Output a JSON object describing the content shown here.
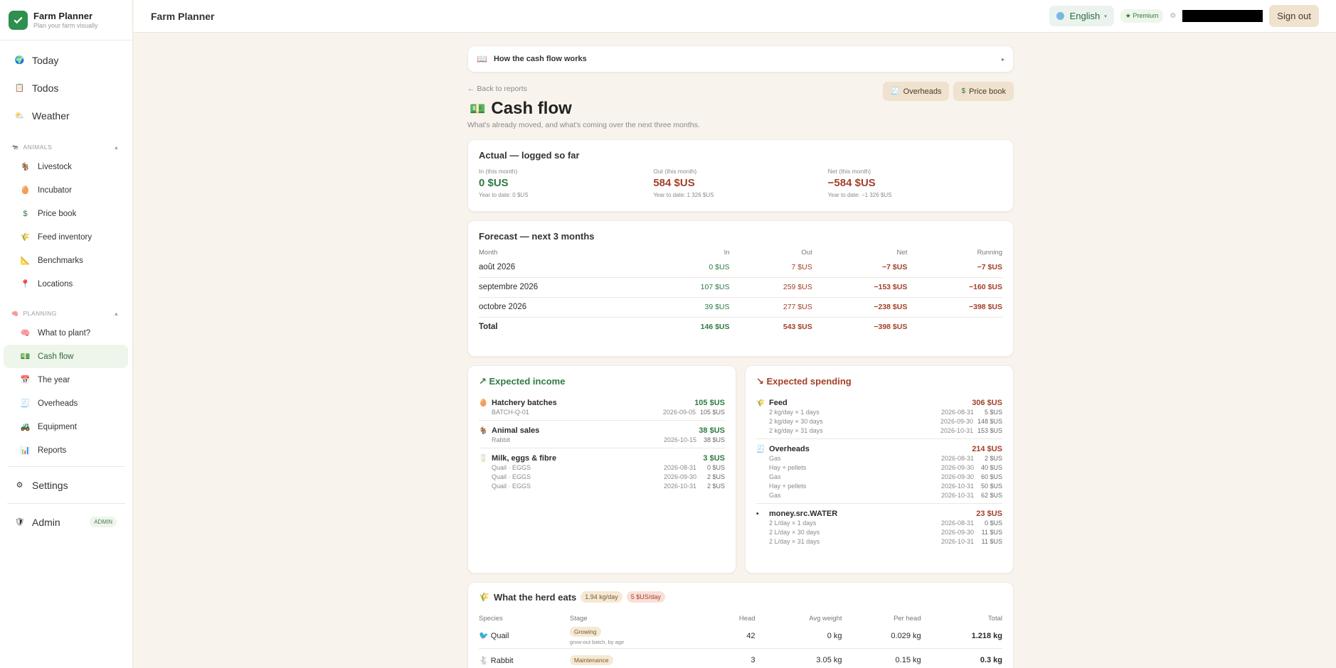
{
  "brand": {
    "title": "Farm Planner",
    "subtitle": "Plan your farm visually"
  },
  "topbar": {
    "title": "Farm Planner",
    "language": "English",
    "premium": "★ Premium",
    "sign_out": "Sign out"
  },
  "nav": {
    "today": "Today",
    "todos": "Todos",
    "weather": "Weather",
    "animals_section": "ANIMALS",
    "animals": [
      "Livestock",
      "Incubator",
      "Price book",
      "Feed inventory",
      "Benchmarks",
      "Locations"
    ],
    "planning_section": "PLANNING",
    "planning": [
      "What to plant?",
      "Cash flow",
      "The year",
      "Overheads",
      "Equipment",
      "Reports"
    ],
    "settings": "Settings",
    "admin": "Admin",
    "admin_badge": "ADMIN"
  },
  "howto": {
    "label": "How the cash flow works",
    "arrow": "▸"
  },
  "header": {
    "back": "← Back to reports",
    "overheads_btn": "Overheads",
    "pricebook_btn": "Price book",
    "title": "Cash flow",
    "subtitle": "What's already moved, and what's coming over the next three months."
  },
  "actual": {
    "title": "Actual — logged so far",
    "metrics": [
      {
        "label": "In (this month)",
        "value": "0 $US",
        "ytd": "Year to date: 0 $US"
      },
      {
        "label": "Out (this month)",
        "value": "584 $US",
        "ytd": "Year to date: 1 326 $US"
      },
      {
        "label": "Net (this month)",
        "value": "−584 $US",
        "ytd": "Year to date: −1 326 $US"
      }
    ]
  },
  "forecast": {
    "title": "Forecast — next 3 months",
    "columns": [
      "Month",
      "In",
      "Out",
      "Net",
      "Running"
    ],
    "rows": [
      [
        "août 2026",
        "0 $US",
        "7 $US",
        "−7 $US",
        "−7 $US"
      ],
      [
        "septembre 2026",
        "107 $US",
        "259 $US",
        "−153 $US",
        "−160 $US"
      ],
      [
        "octobre 2026",
        "39 $US",
        "277 $US",
        "−238 $US",
        "−398 $US"
      ]
    ],
    "total": [
      "Total",
      "146 $US",
      "543 $US",
      "−398 $US",
      ""
    ]
  },
  "income": {
    "title": "↗ Expected income",
    "groups": [
      {
        "name": "Hatchery batches",
        "total": "105 $US",
        "lines": [
          [
            "BATCH-Q-01",
            "2026-09-05",
            "105 $US"
          ]
        ]
      },
      {
        "name": "Animal sales",
        "total": "38 $US",
        "lines": [
          [
            "Rabbit",
            "2026-10-15",
            "38 $US"
          ]
        ]
      },
      {
        "name": "Milk, eggs & fibre",
        "total": "3 $US",
        "lines": [
          [
            "Quail · EGGS",
            "2026-08-31",
            "0 $US"
          ],
          [
            "Quail · EGGS",
            "2026-09-30",
            "2 $US"
          ],
          [
            "Quail · EGGS",
            "2026-10-31",
            "2 $US"
          ]
        ]
      }
    ]
  },
  "spending": {
    "title": "↘ Expected spending",
    "groups": [
      {
        "name": "Feed",
        "total": "306 $US",
        "lines": [
          [
            "2 kg/day × 1 days",
            "2026-08-31",
            "5 $US"
          ],
          [
            "2 kg/day × 30 days",
            "2026-09-30",
            "148 $US"
          ],
          [
            "2 kg/day × 31 days",
            "2026-10-31",
            "153 $US"
          ]
        ]
      },
      {
        "name": "Overheads",
        "total": "214 $US",
        "lines": [
          [
            "Gas",
            "2026-08-31",
            "2 $US"
          ],
          [
            "Hay + pellets",
            "2026-09-30",
            "40 $US"
          ],
          [
            "Gas",
            "2026-09-30",
            "60 $US"
          ],
          [
            "Hay + pellets",
            "2026-10-31",
            "50 $US"
          ],
          [
            "Gas",
            "2026-10-31",
            "62 $US"
          ]
        ]
      },
      {
        "name": "money.src.WATER",
        "total": "23 $US",
        "lines": [
          [
            "2 L/day × 1 days",
            "2026-08-31",
            "0 $US"
          ],
          [
            "2 L/day × 30 days",
            "2026-09-30",
            "11 $US"
          ],
          [
            "2 L/day × 31 days",
            "2026-10-31",
            "11 $US"
          ]
        ]
      }
    ]
  },
  "herd": {
    "title": "What the herd eats",
    "chip1": "1.94 kg/day",
    "chip2": "5 $US/day",
    "columns": [
      "Species",
      "Stage",
      "Head",
      "Avg weight",
      "Per head",
      "Total"
    ],
    "rows": [
      {
        "species": "Quail",
        "stage": "Growing",
        "note": "grow-out batch, by age",
        "head": "42",
        "avg": "0 kg",
        "per": "0.029 kg",
        "total": "1.218 kg"
      },
      {
        "species": "Rabbit",
        "stage": "Maintenance",
        "note": "",
        "head": "3",
        "avg": "3.05 kg",
        "per": "0.15 kg",
        "total": "0.3 kg"
      }
    ]
  },
  "colors": {
    "accent": "#2f7a45",
    "negative": "#a3402a",
    "background": "#f8f3ec"
  }
}
